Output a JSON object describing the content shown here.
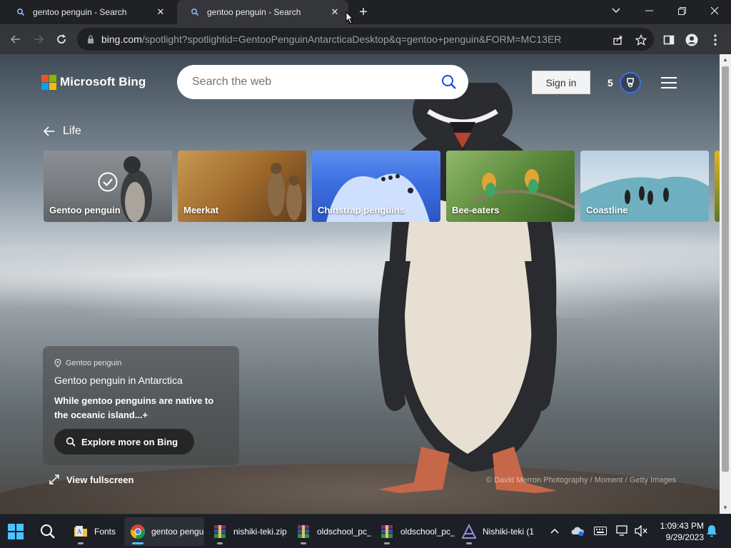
{
  "browser": {
    "tabs": [
      {
        "title": "gentoo penguin - Search",
        "active": false
      },
      {
        "title": "gentoo penguin - Search",
        "active": true
      }
    ],
    "url_host": "bing.com",
    "url_path": "/spotlight?spotlightid=GentooPenguinAntarcticaDesktop&q=gentoo+penguin&FORM=MC13ER"
  },
  "bing": {
    "logo_text": "Microsoft Bing",
    "search_placeholder": "Search the web",
    "signin_label": "Sign in",
    "rewards_count": "5",
    "breadcrumb": "Life",
    "cards": [
      {
        "label": "Gentoo penguin",
        "selected": true
      },
      {
        "label": "Meerkat",
        "selected": false
      },
      {
        "label": "Chinstrap penguins",
        "selected": false
      },
      {
        "label": "Bee-eaters",
        "selected": false
      },
      {
        "label": "Coastline",
        "selected": false
      }
    ],
    "info": {
      "location": "Gentoo penguin",
      "headline": "Gentoo penguin in Antarctica",
      "description": "While gentoo penguins are native to the oceanic island...",
      "expand_symbol": "+",
      "explore_label": "Explore more on Bing"
    },
    "fullscreen_label": "View fullscreen",
    "photo_credit": "© David Merron Photography / Moment / Getty Images"
  },
  "taskbar": {
    "items": [
      {
        "label": "Fonts",
        "icon": "folder-icon"
      },
      {
        "label": "gentoo pengu",
        "icon": "chrome-icon",
        "active": true
      },
      {
        "label": "nishiki-teki.zip",
        "icon": "winrar-icon"
      },
      {
        "label": "oldschool_pc_",
        "icon": "winrar-icon"
      },
      {
        "label": "oldschool_pc_",
        "icon": "winrar-icon"
      },
      {
        "label": "Nishiki-teki (1",
        "icon": "fontforge-icon"
      }
    ],
    "time": "1:09:43 PM",
    "date": "9/29/2023"
  },
  "colors": {
    "accent_blue": "#4cc2ff",
    "bing_blue": "#174ae4",
    "chrome_dark": "#202124"
  }
}
